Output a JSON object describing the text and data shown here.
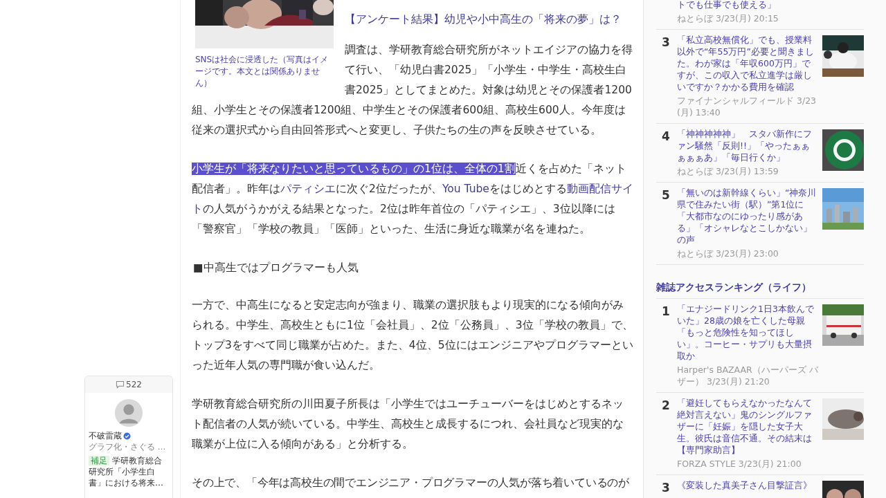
{
  "article": {
    "photo_caption": "SNSは社会に浸透した（写真はイメージです。本文とは関係ありません）",
    "related_link": "【アンケート結果】幼児や小中高生の「将来の夢」は？",
    "lead_text": "調査は、学研教育総合研究所がネットエイジアの協力を得て行い、「幼児白書2025」「小学生・中学生・高校生白書2025」としてまとめた。対象は幼児とその保護者1200",
    "blocks": [
      {
        "kind": "paragraph",
        "segments": [
          {
            "kind": "plain",
            "text": "組、小学生とその保護者1200組、中学生とその保護者600組、高校生600人。今年度は従来の選択式から自由回答形式へと変更し、子供たちの生の声を反映させている。"
          }
        ]
      },
      {
        "kind": "paragraph",
        "segments": [
          {
            "kind": "selected",
            "text": "小学生が「将来なりたいと思っているもの」の1位は、全体の1割"
          },
          {
            "kind": "plain",
            "text": "近くを占めた「ネット配信者」。昨年は"
          },
          {
            "kind": "link",
            "text": "パティシエ"
          },
          {
            "kind": "plain",
            "text": "に次ぐ2位だったが、"
          },
          {
            "kind": "link",
            "text": "You Tube"
          },
          {
            "kind": "plain",
            "text": "をはじめとする"
          },
          {
            "kind": "link",
            "text": "動画配信サイト"
          },
          {
            "kind": "plain",
            "text": "の人気がうかがえる結果となった。2位は昨年首位の「パティシエ」、3位以降には「警察官」「学校の教員」「医師」といった、生活に身近な職業が名を連ねた。"
          }
        ]
      },
      {
        "kind": "heading",
        "segments": [
          {
            "kind": "plain",
            "text": "■中高生ではプログラマーも人気"
          }
        ]
      },
      {
        "kind": "paragraph",
        "segments": [
          {
            "kind": "plain",
            "text": "一方で、中高生になると安定志向が強まり、職業の選択肢もより現実的になる傾向がみられる。中学生、高校生ともに1位「会社員」、2位「公務員」、3位「学校の教員」で、トップ3をすべて同じ職業が占めた。また、4位、5位にはエンジニアやプログラマーといった近年人気の専門職が食い込んだ。"
          }
        ]
      },
      {
        "kind": "paragraph",
        "segments": [
          {
            "kind": "plain",
            "text": "学研教育総合研究所の川田夏子所長は「小学生ではユーチューバーをはじめとするネット配信者の人気が続いている。中学生、高校生と成長するにつれ、会社員など現実的な職業が上位に入る傾向がある」と分析する。"
          }
        ]
      },
      {
        "kind": "paragraph",
        "segments": [
          {
            "kind": "plain",
            "text": "その上で、「今年は高校生の間でエンジニア・プログラマーの人気が落ち着いているのが"
          }
        ]
      }
    ]
  },
  "comment_card": {
    "count": "522",
    "author": "不破雷蔵",
    "verified": true,
    "author_subtitle": "グラフ化・さぐる …",
    "tag": "補足",
    "excerpt": "学研教育総合研究所「小学生白書」における将来…"
  },
  "sidebar": {
    "sections": [
      {
        "items": [
          {
            "title": "トでも仕事でも使える」",
            "meta": "ねとらぼ 3/23(月) 20:15"
          },
          {
            "rank": "3",
            "title": "「私立高校無償化」でも、授業料以外で“年55万円”必要と聞きました。わが家は「年収600万円」ですが、この収入で私立進学は厳しいですか？かかる費用を確認",
            "meta": "ファイナンシャルフィールド 3/23(月) 13:40"
          },
          {
            "rank": "4",
            "title": "「神神神神神」　スタバ新作にファン騒然「反則!!」「やったぁぁぁぁぁあ」「毎日行くか」",
            "meta": "ねとらぼ 3/23(月) 13:59"
          },
          {
            "rank": "5",
            "title": "「無いのは新幹線くらい」“神奈川県で住みたい街（駅）”第1位に「大都市なのにゆったり感がある」「オシャレなとこしかない」の声",
            "meta": "ねとらぼ 3/23(月) 23:00"
          }
        ]
      },
      {
        "heading": "雑誌アクセスランキング（ライフ）",
        "items": [
          {
            "rank": "1",
            "title": "「エナジードリンク1日3本飲んでいた」28歳の娘を亡くした母親「もっと危険性を知ってほしい」。コーヒー・サプリも大量摂取か",
            "meta": "Harper's BAZAAR（ハーパーズ バザー） 3/23(月) 21:20"
          },
          {
            "rank": "2",
            "title": "「避妊してもらえなかったなんて絶対言えない」鬼のシングルファザーに「妊娠」を隠した女子大生。彼氏は音信不通。その結末は【専門家助言】",
            "meta": "FORZA STYLE 3/23(月) 21:00"
          },
          {
            "rank": "3",
            "title": "《変装した真美子さん目撃証言》"
          }
        ]
      }
    ]
  }
}
